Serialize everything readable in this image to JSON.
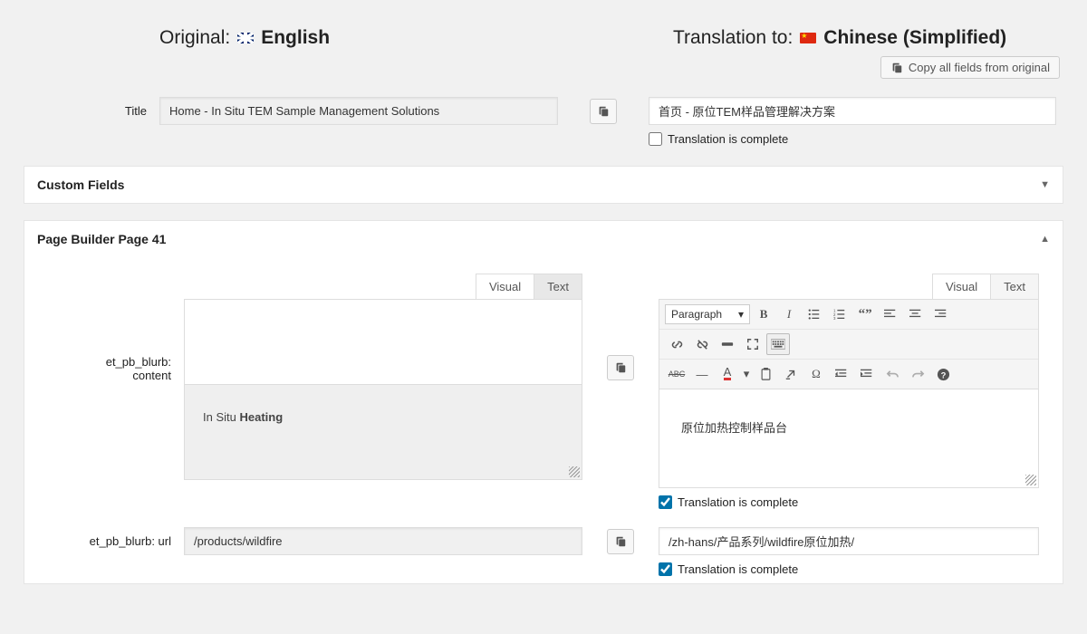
{
  "header": {
    "original_label": "Original:",
    "original_lang": "English",
    "translation_label": "Translation to:",
    "translation_lang": "Chinese (Simplified)",
    "copy_all_btn": "Copy all fields from original"
  },
  "title_field": {
    "label": "Title",
    "original": "Home - In Situ TEM Sample Management Solutions",
    "translation": "首页 - 原位TEM样品管理解决方案",
    "complete_label": "Translation is complete",
    "complete_checked": false
  },
  "panels": {
    "custom_fields": {
      "title": "Custom Fields"
    },
    "page_builder": {
      "title": "Page Builder Page 41"
    }
  },
  "editor_tabs": {
    "visual": "Visual",
    "text": "Text"
  },
  "editor": {
    "label_line1": "et_pb_blurb:",
    "label_line2": "content",
    "original_prefix": "In Situ ",
    "original_bold": "Heating",
    "format_select": "Paragraph",
    "translation": "原位加热控制样品台",
    "complete_label": "Translation is complete",
    "complete_checked": true
  },
  "url_field": {
    "label": "et_pb_blurb: url",
    "original": "/products/wildfire",
    "translation": "/zh-hans/产品系列/wildfire原位加热/",
    "complete_label": "Translation is complete",
    "complete_checked": true
  },
  "toolbar_row1": [
    "bold",
    "italic",
    "ul",
    "ol",
    "quote",
    "align-left",
    "align-center",
    "align-right"
  ],
  "toolbar_row2": [
    "link",
    "unlink",
    "fullwidth",
    "fullscreen",
    "keyboard"
  ],
  "toolbar_row3": [
    "strike",
    "hr",
    "text-color",
    "caret",
    "paste",
    "clear",
    "omega",
    "outdent",
    "indent",
    "undo",
    "redo",
    "help"
  ]
}
